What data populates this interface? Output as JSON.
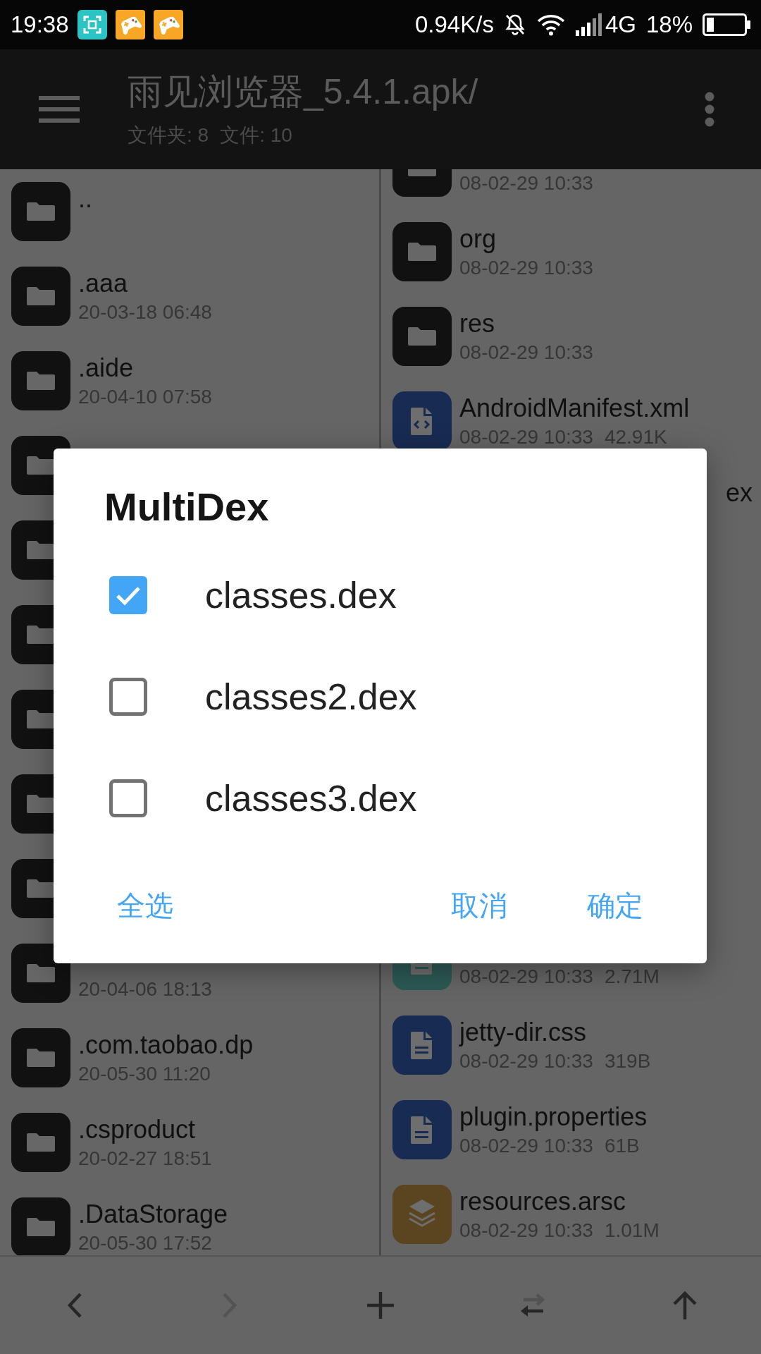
{
  "status_bar": {
    "time": "19:38",
    "net_speed": "0.94K/s",
    "network_type": "4G",
    "battery": "18%"
  },
  "toolbar": {
    "title": "雨见浏览器_5.4.1.apk/",
    "folder_count": "文件夹: 8",
    "file_count": "文件: 10"
  },
  "left_pane": {
    "rows": [
      {
        "kind": "folder",
        "name": ".."
      },
      {
        "kind": "folder",
        "name": ".aaa",
        "date": "20-03-18 06:48"
      },
      {
        "kind": "folder",
        "name": ".aide",
        "date": "20-04-10 07:58"
      },
      {
        "kind": "folder"
      },
      {
        "kind": "folder"
      },
      {
        "kind": "folder"
      },
      {
        "kind": "folder"
      },
      {
        "kind": "folder"
      },
      {
        "kind": "folder"
      },
      {
        "kind": "folder",
        "date": "20-04-06 18:13"
      },
      {
        "kind": "folder",
        "name": ".com.taobao.dp",
        "date": "20-05-30 11:20"
      },
      {
        "kind": "folder",
        "name": ".csproduct",
        "date": "20-02-27 18:51"
      },
      {
        "kind": "folder",
        "name": ".DataStorage",
        "date": "20-05-30 17:52"
      }
    ]
  },
  "right_pane": {
    "upper_rows": [
      {
        "kind": "folder",
        "date": "08-02-29 10:33"
      },
      {
        "kind": "folder",
        "name": "org",
        "date": "08-02-29 10:33"
      },
      {
        "kind": "folder",
        "name": "res",
        "date": "08-02-29 10:33"
      },
      {
        "kind": "code",
        "name": "AndroidManifest.xml",
        "date": "08-02-29 10:33",
        "size": "42.91K"
      },
      {
        "name_tail": "ex"
      }
    ],
    "lower_rows": [
      {
        "kind": "dex",
        "date": "08-02-29 10:33",
        "size": "2.71M"
      },
      {
        "kind": "text",
        "name": "jetty-dir.css",
        "date": "08-02-29 10:33",
        "size": "319B"
      },
      {
        "kind": "text",
        "name": "plugin.properties",
        "date": "08-02-29 10:33",
        "size": "61B"
      },
      {
        "kind": "archive",
        "name": "resources.arsc",
        "date": "08-02-29 10:33",
        "size": "1.01M"
      }
    ]
  },
  "bottom_bar": {
    "buttons": [
      {
        "kind": "back",
        "disabled": false
      },
      {
        "kind": "forward",
        "disabled": true
      },
      {
        "kind": "add",
        "disabled": false
      },
      {
        "kind": "swap",
        "disabled": false
      },
      {
        "kind": "up",
        "disabled": false
      }
    ]
  },
  "dialog": {
    "title": "MultiDex",
    "options": [
      {
        "label": "classes.dex",
        "checked": true
      },
      {
        "label": "classes2.dex",
        "checked": false
      },
      {
        "label": "classes3.dex",
        "checked": false
      }
    ],
    "neutral_buttons": [
      {
        "label": "全选"
      }
    ],
    "action_buttons": [
      {
        "label": "取消"
      },
      {
        "label": "确定"
      }
    ]
  }
}
